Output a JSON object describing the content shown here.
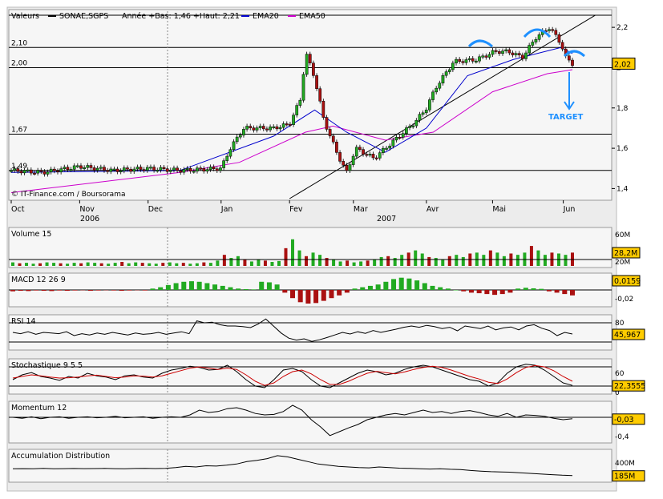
{
  "header": {
    "valeurs_label": "Valeurs",
    "ticker": "SONAE,SGPS",
    "range_text": "Année +Bas: 1,46 +Haut: 2,21",
    "ema20_label": "EMA20",
    "ema50_label": "EMA50"
  },
  "copyright": "© IT-Finance.com / Boursorama",
  "colors": {
    "price_line": "#000000",
    "ema20": "#0000cc",
    "ema50": "#cc00cc",
    "up": "#22aa22",
    "down": "#aa1111",
    "annotation": "#1e90ff",
    "value_box": "#ffcc00",
    "grid_bg": "#f4f4f4"
  },
  "time_axis": {
    "months": [
      "Oct",
      "Nov",
      "Dec",
      "Jan",
      "Fev",
      "Mar",
      "Avr",
      "Mai",
      "Jun"
    ],
    "years": [
      "2006",
      "2007"
    ]
  },
  "annotation": {
    "target_label": "TARGET"
  },
  "chart_data": [
    {
      "type": "candlestick",
      "title": "SONAE,SGPS",
      "ylim": [
        1.35,
        2.28
      ],
      "y_ticks": [
        "2,2",
        "2",
        "1,8",
        "1,6",
        "1,4"
      ],
      "left_levels": [
        "2,10",
        "2,00",
        "1,67",
        "1,49"
      ],
      "level_values": [
        2.1,
        2.0,
        1.67,
        1.49
      ],
      "last_value": "2,02",
      "series": [
        {
          "name": "EMA20",
          "color": "#0000cc"
        },
        {
          "name": "EMA50",
          "color": "#cc00cc"
        }
      ],
      "price_path": [
        [
          "2006-10-02",
          1.49
        ],
        [
          "2006-10-16",
          1.48
        ],
        [
          "2006-11-01",
          1.51
        ],
        [
          "2006-11-15",
          1.49
        ],
        [
          "2006-12-01",
          1.5
        ],
        [
          "2006-12-15",
          1.49
        ],
        [
          "2007-01-02",
          1.5
        ],
        [
          "2007-01-06",
          1.6
        ],
        [
          "2007-01-12",
          1.7
        ],
        [
          "2007-01-25",
          1.7
        ],
        [
          "2007-02-01",
          1.72
        ],
        [
          "2007-02-06",
          1.85
        ],
        [
          "2007-02-08",
          2.08
        ],
        [
          "2007-02-12",
          1.95
        ],
        [
          "2007-02-16",
          1.74
        ],
        [
          "2007-02-22",
          1.57
        ],
        [
          "2007-02-26",
          1.48
        ],
        [
          "2007-03-02",
          1.6
        ],
        [
          "2007-03-10",
          1.55
        ],
        [
          "2007-03-20",
          1.65
        ],
        [
          "2007-03-28",
          1.73
        ],
        [
          "2007-04-02",
          1.8
        ],
        [
          "2007-04-06",
          1.9
        ],
        [
          "2007-04-14",
          2.03
        ],
        [
          "2007-04-24",
          2.04
        ],
        [
          "2007-05-02",
          2.08
        ],
        [
          "2007-05-08",
          2.08
        ],
        [
          "2007-05-14",
          2.05
        ],
        [
          "2007-05-20",
          2.15
        ],
        [
          "2007-05-26",
          2.2
        ],
        [
          "2007-05-31",
          2.12
        ],
        [
          "2007-06-02",
          2.05
        ],
        [
          "2007-06-05",
          2.02
        ]
      ],
      "ema20_path": [
        [
          "2006-10-02",
          1.48
        ],
        [
          "2006-12-15",
          1.49
        ],
        [
          "2007-01-25",
          1.66
        ],
        [
          "2007-02-12",
          1.79
        ],
        [
          "2007-02-26",
          1.68
        ],
        [
          "2007-03-15",
          1.58
        ],
        [
          "2007-04-02",
          1.7
        ],
        [
          "2007-04-20",
          1.96
        ],
        [
          "2007-05-10",
          2.04
        ],
        [
          "2007-05-31",
          2.1
        ],
        [
          "2007-06-05",
          2.07
        ]
      ],
      "ema50_path": [
        [
          "2006-10-02",
          1.38
        ],
        [
          "2006-12-15",
          1.48
        ],
        [
          "2007-01-10",
          1.53
        ],
        [
          "2007-02-08",
          1.68
        ],
        [
          "2007-02-20",
          1.71
        ],
        [
          "2007-03-15",
          1.64
        ],
        [
          "2007-04-05",
          1.68
        ],
        [
          "2007-05-01",
          1.88
        ],
        [
          "2007-05-25",
          1.97
        ],
        [
          "2007-06-05",
          1.99
        ]
      ],
      "trendline": [
        [
          "2007-02-01",
          1.35
        ],
        [
          "2007-06-15",
          2.26
        ]
      ]
    },
    {
      "type": "bar",
      "title": "Volume 15",
      "y_ticks": [
        "60M",
        "20M"
      ],
      "last_value": "28,2M",
      "values": [
        8,
        6,
        7,
        5,
        6,
        8,
        7,
        6,
        5,
        7,
        6,
        8,
        7,
        6,
        5,
        7,
        9,
        6,
        8,
        7,
        6,
        5,
        7,
        8,
        6,
        7,
        5,
        6,
        8,
        7,
        12,
        25,
        18,
        22,
        15,
        10,
        14,
        12,
        9,
        11,
        40,
        60,
        35,
        22,
        30,
        25,
        18,
        14,
        10,
        12,
        8,
        10,
        12,
        15,
        20,
        22,
        18,
        25,
        30,
        35,
        28,
        20,
        18,
        15,
        22,
        25,
        20,
        28,
        30,
        25,
        35,
        30,
        22,
        28,
        25,
        30,
        45,
        35,
        25,
        30,
        28,
        25,
        30
      ],
      "ma_color": "#aa0000"
    },
    {
      "type": "bar",
      "title": "MACD 12 26 9",
      "y_ticks": [
        "0,02",
        "-0,02"
      ],
      "last_value": "0,0159",
      "values": [
        -0.005,
        -0.003,
        -0.004,
        -0.002,
        -0.003,
        -0.004,
        -0.002,
        -0.003,
        -0.002,
        -0.001,
        -0.003,
        -0.002,
        -0.001,
        -0.002,
        -0.003,
        -0.002,
        -0.001,
        -0.002,
        0.005,
        0.01,
        0.018,
        0.025,
        0.03,
        0.032,
        0.03,
        0.025,
        0.02,
        0.015,
        0.01,
        0.005,
        0.003,
        0.002,
        0.03,
        0.028,
        0.02,
        -0.01,
        -0.03,
        -0.045,
        -0.05,
        -0.048,
        -0.04,
        -0.03,
        -0.02,
        -0.01,
        0.005,
        0.01,
        0.015,
        0.02,
        0.03,
        0.04,
        0.045,
        0.042,
        0.035,
        0.025,
        0.015,
        0.01,
        0.005,
        0.0,
        -0.005,
        -0.01,
        -0.012,
        -0.015,
        -0.018,
        -0.015,
        -0.01,
        0.005,
        0.008,
        0.006,
        0.004,
        -0.005,
        -0.01,
        -0.015,
        -0.02
      ]
    },
    {
      "type": "line",
      "title": "RSI 14",
      "y_ticks": [
        "80"
      ],
      "last_value": "45,967",
      "ylim": [
        0,
        100
      ],
      "guides": [
        80,
        20
      ],
      "values": [
        50,
        46,
        52,
        44,
        50,
        48,
        46,
        52,
        40,
        46,
        42,
        48,
        44,
        50,
        46,
        42,
        48,
        44,
        46,
        50,
        44,
        48,
        52,
        46,
        86,
        80,
        82,
        74,
        70,
        70,
        68,
        65,
        76,
        92,
        70,
        48,
        32,
        26,
        30,
        22,
        27,
        34,
        42,
        50,
        45,
        52,
        47,
        56,
        50,
        55,
        60,
        66,
        70,
        66,
        72,
        68,
        62,
        66,
        55,
        70,
        66,
        62,
        70,
        58,
        64,
        67,
        58,
        70,
        74,
        63,
        56,
        40,
        50,
        45
      ]
    },
    {
      "type": "line",
      "title": "Stochastique 9 5 5",
      "y_ticks": [
        "60",
        "0"
      ],
      "last_value": "22,3555",
      "ylim": [
        0,
        100
      ],
      "guides": [
        80,
        20
      ],
      "series": [
        {
          "name": "%K",
          "color": "#000000",
          "values": [
            40,
            55,
            62,
            50,
            45,
            38,
            50,
            45,
            60,
            52,
            48,
            40,
            52,
            55,
            48,
            45,
            60,
            70,
            75,
            82,
            78,
            70,
            72,
            85,
            65,
            40,
            20,
            15,
            40,
            70,
            75,
            65,
            40,
            20,
            15,
            30,
            45,
            60,
            70,
            65,
            55,
            60,
            72,
            80,
            85,
            80,
            70,
            60,
            50,
            40,
            35,
            20,
            30,
            60,
            80,
            88,
            85,
            70,
            50,
            30,
            22
          ]
        },
        {
          "name": "%D",
          "color": "#cc0000",
          "values": [
            45,
            50,
            55,
            52,
            48,
            45,
            46,
            48,
            52,
            54,
            50,
            46,
            48,
            52,
            51,
            48,
            52,
            60,
            68,
            76,
            80,
            76,
            72,
            76,
            72,
            55,
            35,
            22,
            30,
            50,
            65,
            70,
            58,
            40,
            25,
            25,
            35,
            48,
            60,
            66,
            62,
            58,
            64,
            72,
            78,
            82,
            78,
            70,
            60,
            50,
            42,
            32,
            28,
            42,
            62,
            78,
            84,
            80,
            68,
            50,
            35
          ]
        }
      ]
    },
    {
      "type": "line",
      "title": "Momentum 12",
      "y_ticks": [
        "-0,4"
      ],
      "last_value": "-0,03",
      "ylim": [
        -0.5,
        0.3
      ],
      "guides": [
        0
      ],
      "values": [
        0.0,
        -0.02,
        0.01,
        -0.03,
        0.0,
        0.01,
        -0.02,
        0.0,
        0.01,
        -0.01,
        0.0,
        0.02,
        -0.01,
        0.0,
        0.01,
        -0.02,
        0.0,
        0.01,
        0.0,
        0.05,
        0.15,
        0.1,
        0.12,
        0.18,
        0.2,
        0.15,
        0.08,
        0.05,
        0.06,
        0.12,
        0.25,
        0.15,
        -0.05,
        -0.2,
        -0.38,
        -0.3,
        -0.22,
        -0.15,
        -0.05,
        0.0,
        0.05,
        0.08,
        0.05,
        0.1,
        0.15,
        0.1,
        0.12,
        0.08,
        0.12,
        0.14,
        0.1,
        0.05,
        0.02,
        0.08,
        0.0,
        0.05,
        0.04,
        0.02,
        -0.02,
        -0.05,
        -0.03
      ]
    },
    {
      "type": "line",
      "title": "Accumulation Distribution",
      "y_ticks": [
        "400M"
      ],
      "last_value": "185M",
      "ylim": [
        100,
        600
      ],
      "values": [
        300,
        302,
        298,
        305,
        300,
        302,
        304,
        301,
        303,
        305,
        302,
        300,
        304,
        306,
        303,
        305,
        320,
        340,
        330,
        350,
        345,
        360,
        380,
        420,
        440,
        470,
        520,
        500,
        460,
        420,
        380,
        360,
        340,
        330,
        320,
        315,
        330,
        320,
        310,
        305,
        300,
        295,
        300,
        290,
        285,
        270,
        260,
        250,
        245,
        240,
        230,
        220,
        210,
        200,
        190,
        185
      ]
    }
  ]
}
